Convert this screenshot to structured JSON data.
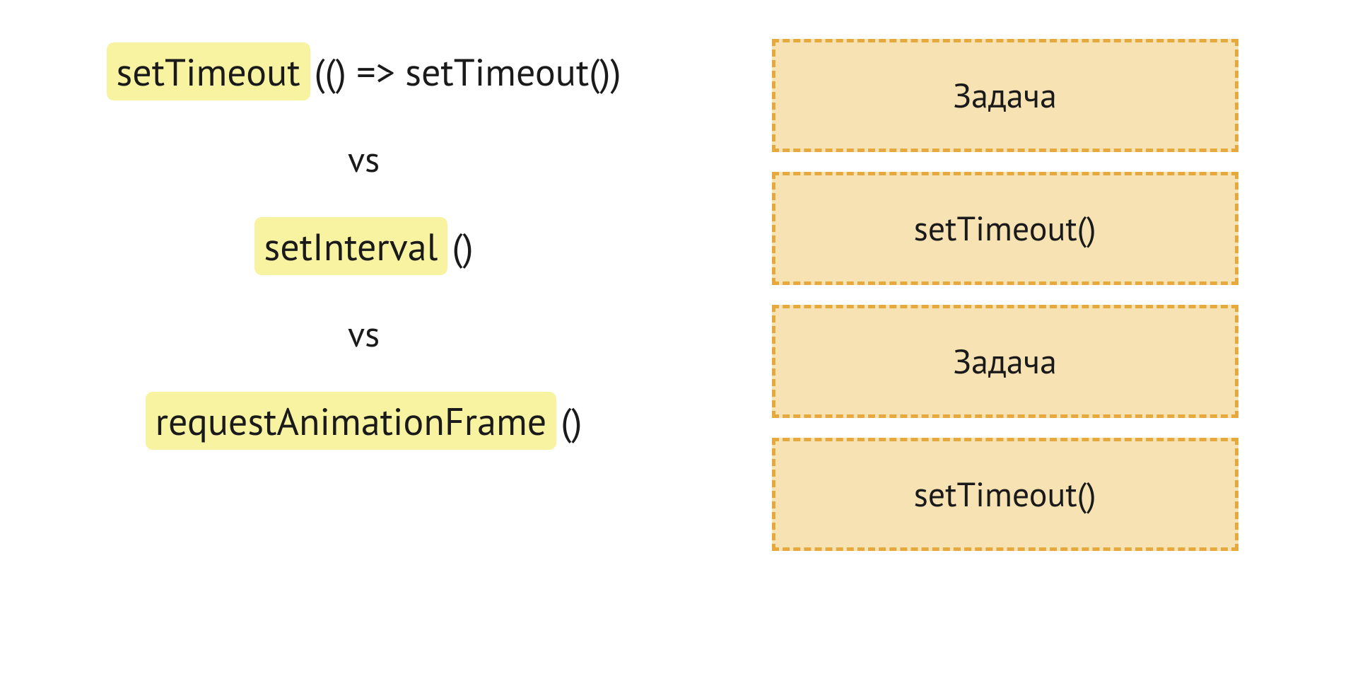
{
  "left": {
    "line1": {
      "highlighted": "setTimeout",
      "rest": " (() => setTimeout())"
    },
    "vs1": "vs",
    "line2": {
      "highlighted": "setInterval",
      "rest": " ()"
    },
    "vs2": "vs",
    "line3": {
      "highlighted": "requestAnimationFrame",
      "rest": " ()"
    }
  },
  "right": {
    "boxes": [
      "Задача",
      "setTimeout()",
      "Задача",
      "setTimeout()"
    ]
  },
  "colors": {
    "highlight_bg": "#f8f3a1",
    "box_bg": "#f6e2b3",
    "box_border": "#e5a93e"
  }
}
